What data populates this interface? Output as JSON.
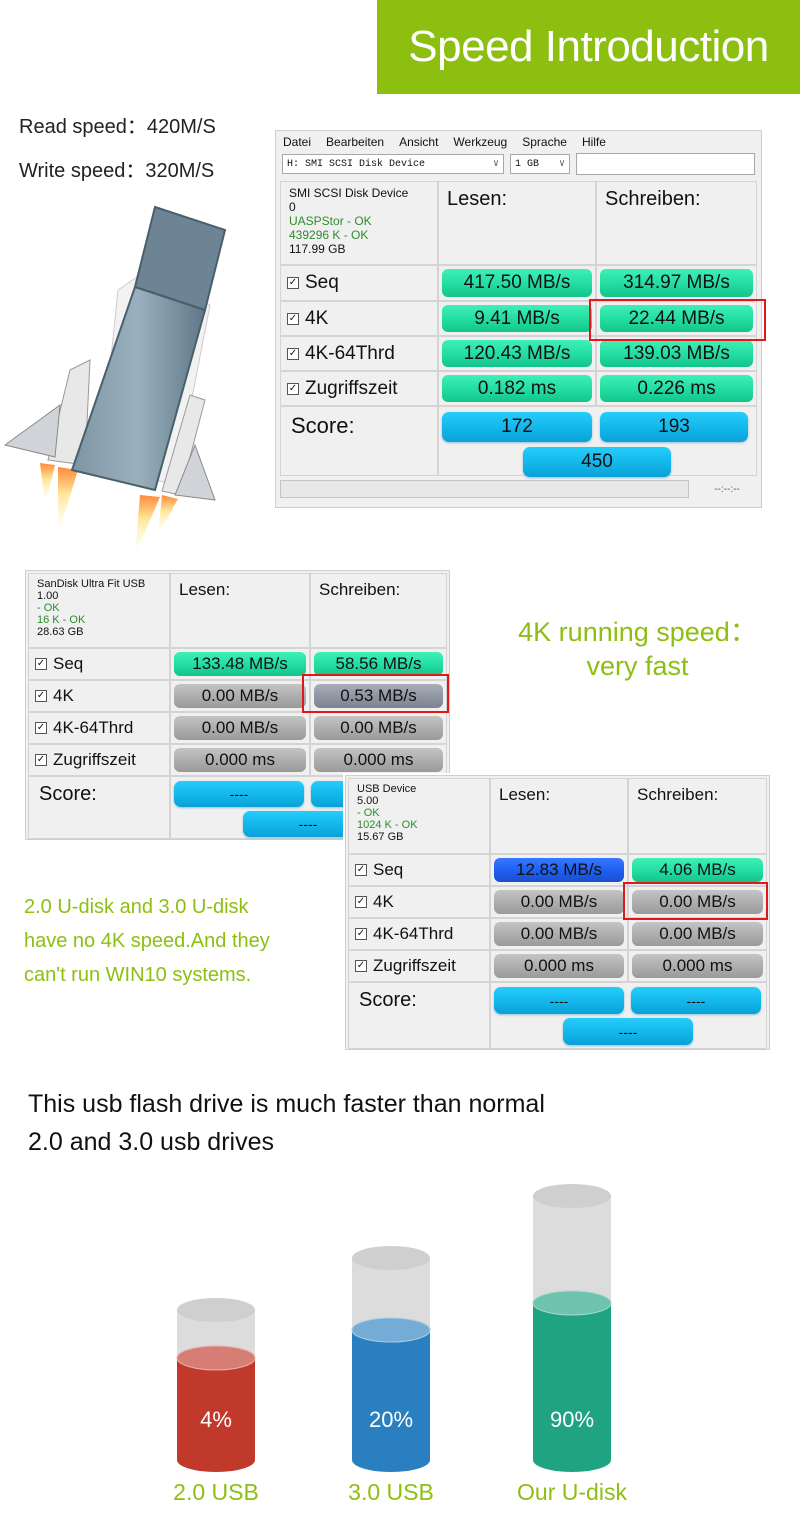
{
  "banner": {
    "title": "Speed Introduction",
    "color": "#8dbf11"
  },
  "specs": {
    "read": "Read speed：420M/S",
    "write": "Write speed：320M/S"
  },
  "rocket_image": {
    "icon": "usb-rocket-icon"
  },
  "benchmark_main": {
    "menu": [
      "Datei",
      "Bearbeiten",
      "Ansicht",
      "Werkzeug",
      "Sprache",
      "Hilfe"
    ],
    "drive_select": "H: SMI  SCSI Disk Device",
    "size_select": "1 GB",
    "device": {
      "name": "SMI  SCSI Disk Device",
      "line2": "0",
      "driver": "UASPStor - OK",
      "alignment": "439296 K - OK",
      "capacity": "117.99 GB"
    },
    "col_read": "Lesen:",
    "col_write": "Schreiben:",
    "rows": [
      {
        "label": "Seq",
        "read": "417.50 MB/s",
        "write": "314.97 MB/s"
      },
      {
        "label": "4K",
        "read": "9.41 MB/s",
        "write": "22.44 MB/s"
      },
      {
        "label": "4K-64Thrd",
        "read": "120.43 MB/s",
        "write": "139.03 MB/s"
      },
      {
        "label": "Zugriffszeit",
        "read": "0.182 ms",
        "write": "0.226 ms"
      }
    ],
    "score_label": "Score:",
    "score_read": "172",
    "score_write": "193",
    "score_total": "450",
    "timer": "--:--:--"
  },
  "benchmark_sandisk": {
    "device": {
      "name": "SanDisk Ultra Fit USB",
      "line2": "1.00",
      "driver": " - OK",
      "alignment": "16 K - OK",
      "capacity": "28.63 GB"
    },
    "col_read": "Lesen:",
    "col_write": "Schreiben:",
    "rows": [
      {
        "label": "Seq",
        "read": "133.48 MB/s",
        "write": "58.56 MB/s"
      },
      {
        "label": "4K",
        "read": "0.00 MB/s",
        "write": "0.53 MB/s"
      },
      {
        "label": "4K-64Thrd",
        "read": "0.00 MB/s",
        "write": "0.00 MB/s"
      },
      {
        "label": "Zugriffszeit",
        "read": "0.000 ms",
        "write": "0.000 ms"
      }
    ],
    "score_label": "Score:",
    "score_read": "----",
    "score_write": "----",
    "score_total": "----"
  },
  "benchmark_usb": {
    "device": {
      "name": "USB Device",
      "line2": "5.00",
      "driver": " - OK",
      "alignment": "1024 K - OK",
      "capacity": "15.67 GB"
    },
    "col_read": "Lesen:",
    "col_write": "Schreiben:",
    "rows": [
      {
        "label": "Seq",
        "read": "12.83 MB/s",
        "write": "4.06 MB/s"
      },
      {
        "label": "4K",
        "read": "0.00 MB/s",
        "write": "0.00 MB/s"
      },
      {
        "label": "4K-64Thrd",
        "read": "0.00 MB/s",
        "write": "0.00 MB/s"
      },
      {
        "label": "Zugriffszeit",
        "read": "0.000 ms",
        "write": "0.000 ms"
      }
    ],
    "score_label": "Score:",
    "score_read": "----",
    "score_write": "----",
    "score_total": "----"
  },
  "captions": {
    "fourk_line1": "4K running speed：",
    "fourk_line2": "very fast",
    "no4k_line1": "2.0 U-disk and 3.0 U-disk",
    "no4k_line2": "have no 4K speed.And they",
    "no4k_line3": "can't run WIN10 systems.",
    "compare_line1": "This usb flash drive is much faster than normal",
    "compare_line2": "2.0 and 3.0 usb drives"
  },
  "chart_data": {
    "type": "bar",
    "style": "cylinder",
    "title": "",
    "categories": [
      "2.0 USB",
      "3.0 USB",
      "Our U-disk"
    ],
    "values": [
      4,
      20,
      90
    ],
    "labels": [
      "4%",
      "20%",
      "90%"
    ],
    "colors": [
      "#c0392b",
      "#2a7fc0",
      "#1fa383"
    ],
    "label_color": "#8dbf11",
    "unit": "%"
  }
}
